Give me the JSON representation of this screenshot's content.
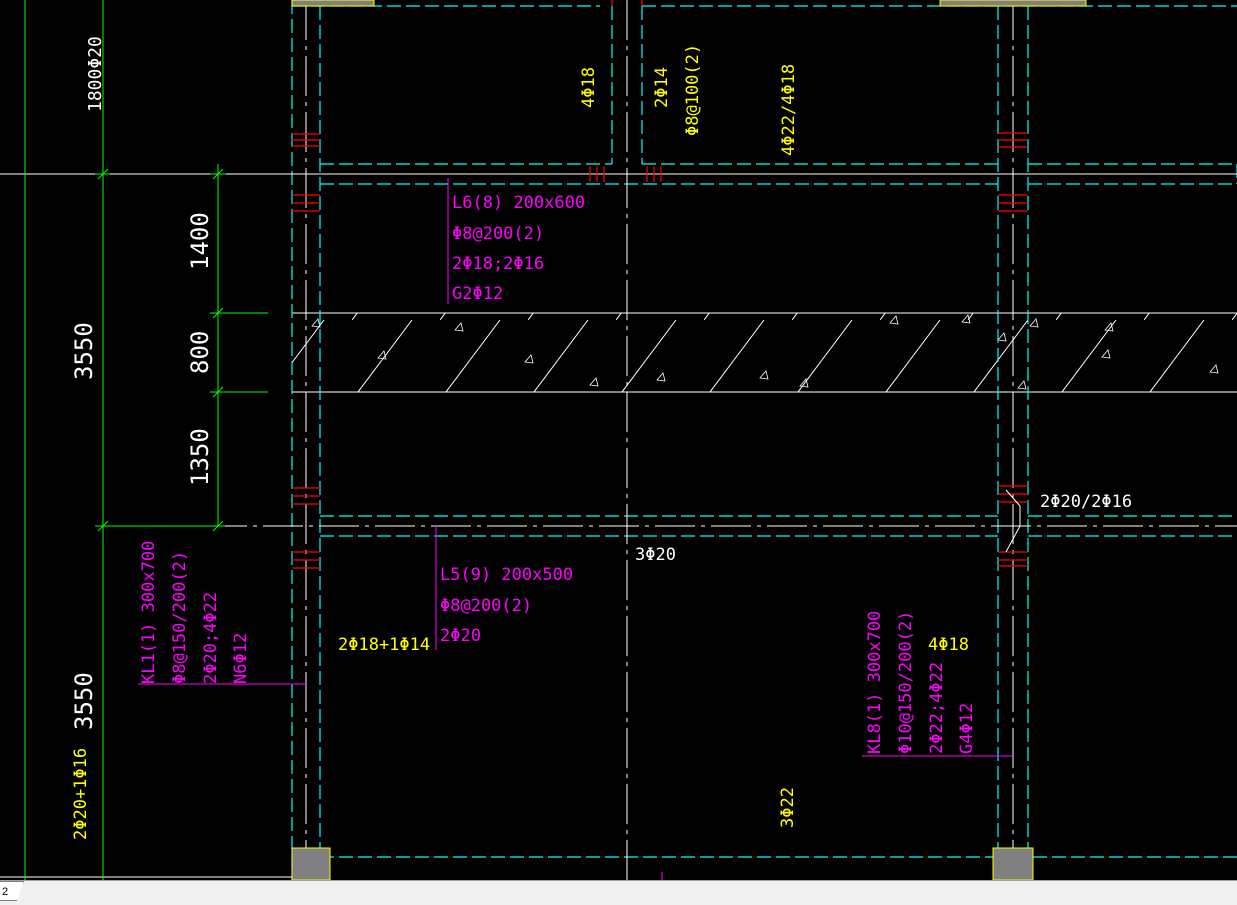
{
  "colors": {
    "background": "#000000",
    "dimension_green": "#00ff00",
    "axis_white": "#ffffff",
    "beam_cyan": "#00ffff",
    "rebar_yellow": "#ffff00",
    "beam_label_magenta": "#ff00ff",
    "stirrup_red": "#ff0000",
    "column_gray": "#808080"
  },
  "dimensions": {
    "top_rebar": "1800Φ20",
    "span_upper": "3550",
    "span_lower": "3550",
    "seg_1400": "1400",
    "seg_800": "800",
    "seg_1350": "1350",
    "left_bottom_rebar": "2Φ20+1Φ16"
  },
  "beams": {
    "l6": {
      "line1": "L6(8) 200x600",
      "line2": "Φ8@200(2)",
      "line3": "2Φ18;2Φ16",
      "line4": "G2Φ12"
    },
    "l5": {
      "line1": "L5(9) 200x500",
      "line2": "Φ8@200(2)",
      "line3": "2Φ20"
    },
    "kl1": {
      "line1": "KL1(1) 300x700",
      "line2": "Φ8@150/200(2)",
      "line3": "2Φ20;4Φ22",
      "line4": "N6Φ12"
    },
    "kl8": {
      "line1": "KL8(1) 300x700",
      "line2": "Φ10@150/200(2)",
      "line3": "2Φ22;4Φ22",
      "line4": "G4Φ12"
    }
  },
  "rebars": {
    "top_4phi18": "4Φ18",
    "top_2phi14": "2Φ14",
    "top_stirrup": "Φ8@100(2)",
    "top_4phi22": "4Φ22/4Φ18",
    "right_2phi20": "2Φ20/2Φ16",
    "mid_3phi20": "3Φ20",
    "left_2phi18": "2Φ18+1Φ14",
    "kl8_4phi18": "4Φ18",
    "bottom_3phi22": "3Φ22"
  },
  "statusbar": {
    "layout_tab": "2"
  }
}
